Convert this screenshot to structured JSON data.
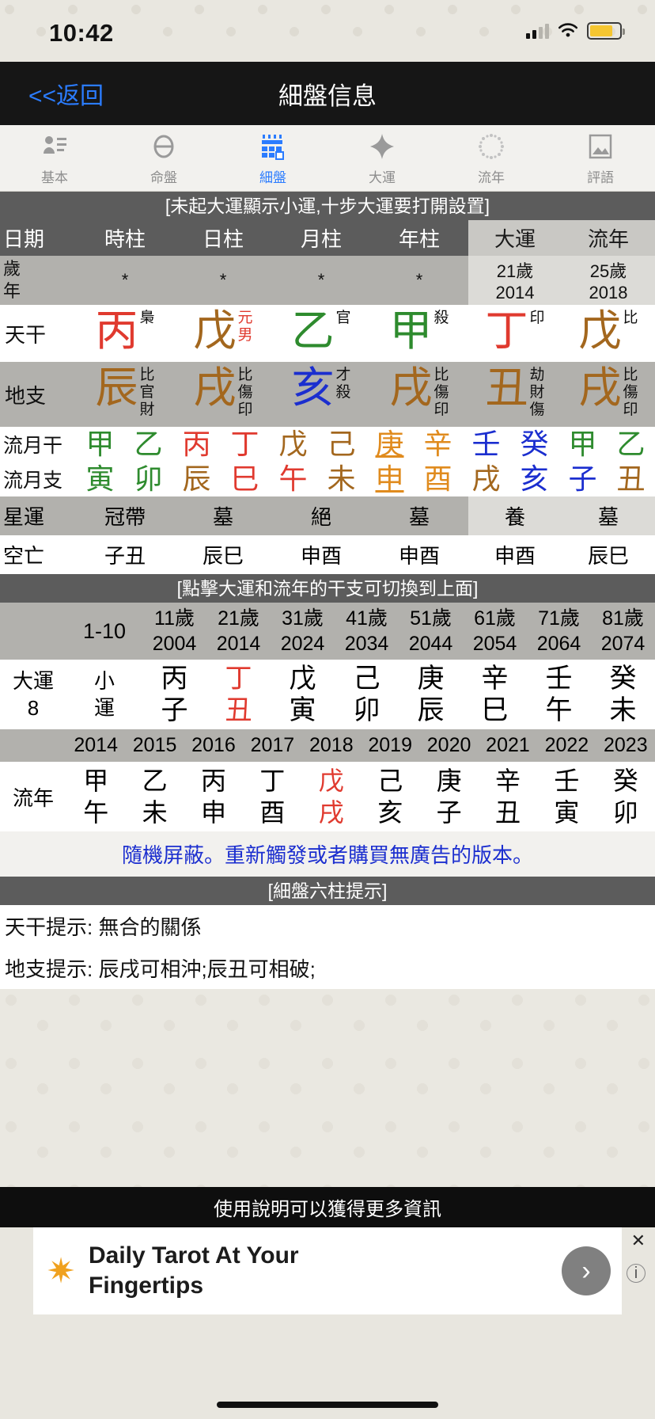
{
  "status": {
    "time": "10:42"
  },
  "nav": {
    "back": "<<返回",
    "title": "細盤信息"
  },
  "tabs": [
    {
      "label": "基本",
      "icon": "person-list-icon",
      "active": false
    },
    {
      "label": "命盤",
      "icon": "oval-divider-icon",
      "active": false
    },
    {
      "label": "細盤",
      "icon": "calendar-grid-icon",
      "active": true
    },
    {
      "label": "大運",
      "icon": "diamond-icon",
      "active": false
    },
    {
      "label": "流年",
      "icon": "dotted-circle-icon",
      "active": false
    },
    {
      "label": "評語",
      "icon": "picture-icon",
      "active": false
    }
  ],
  "notice_top": "[未起大運顯示小運,十步大運要打開設置]",
  "table": {
    "headers": [
      "日期",
      "時柱",
      "日柱",
      "月柱",
      "年柱",
      "大運",
      "流年"
    ],
    "age_label": "歲",
    "year_label": "年",
    "age_values": [
      "*",
      "*",
      "*",
      "*"
    ],
    "dayun": {
      "age": "21歲",
      "year": "2014"
    },
    "liunian": {
      "age": "25歲",
      "year": "2018"
    },
    "stems_label": "天干",
    "stems": [
      {
        "char": "丙",
        "color": "#e03a2f",
        "anns": [
          "梟"
        ],
        "ann_colors": [
          "#111111"
        ]
      },
      {
        "char": "戊",
        "color": "#a3671e",
        "anns": [
          "元",
          "男"
        ],
        "ann_colors": [
          "#e03a2f",
          "#e03a2f"
        ]
      },
      {
        "char": "乙",
        "color": "#2e8b2e",
        "anns": [
          "官"
        ],
        "ann_colors": [
          "#111111"
        ]
      },
      {
        "char": "甲",
        "color": "#2e8b2e",
        "anns": [
          "殺"
        ],
        "ann_colors": [
          "#111111"
        ]
      },
      {
        "char": "丁",
        "color": "#e03a2f",
        "anns": [
          "印"
        ],
        "ann_colors": [
          "#111111"
        ]
      },
      {
        "char": "戊",
        "color": "#a3671e",
        "anns": [
          "比"
        ],
        "ann_colors": [
          "#111111"
        ]
      }
    ],
    "branches_label": "地支",
    "branches": [
      {
        "char": "辰",
        "color": "#a3671e",
        "anns": [
          "比",
          "官",
          "財"
        ]
      },
      {
        "char": "戌",
        "color": "#a3671e",
        "anns": [
          "比",
          "傷",
          "印"
        ]
      },
      {
        "char": "亥",
        "color": "#1b2ecf",
        "anns": [
          "才",
          "殺"
        ]
      },
      {
        "char": "戌",
        "color": "#a3671e",
        "anns": [
          "比",
          "傷",
          "印"
        ]
      },
      {
        "char": "丑",
        "color": "#a3671e",
        "anns": [
          "劫",
          "財",
          "傷"
        ]
      },
      {
        "char": "戌",
        "color": "#a3671e",
        "anns": [
          "比",
          "傷",
          "印"
        ]
      }
    ],
    "month_stem_label": "流月干",
    "month_stems": [
      {
        "c": "甲",
        "color": "#2e8b2e",
        "hl": false
      },
      {
        "c": "乙",
        "color": "#2e8b2e",
        "hl": false
      },
      {
        "c": "丙",
        "color": "#e03a2f",
        "hl": false
      },
      {
        "c": "丁",
        "color": "#e03a2f",
        "hl": false
      },
      {
        "c": "戊",
        "color": "#a3671e",
        "hl": false
      },
      {
        "c": "己",
        "color": "#a3671e",
        "hl": false
      },
      {
        "c": "庚",
        "color": "#e08b1e",
        "hl": true
      },
      {
        "c": "辛",
        "color": "#e08b1e",
        "hl": false
      },
      {
        "c": "壬",
        "color": "#1b2ecf",
        "hl": false
      },
      {
        "c": "癸",
        "color": "#1b2ecf",
        "hl": false
      },
      {
        "c": "甲",
        "color": "#2e8b2e",
        "hl": false
      },
      {
        "c": "乙",
        "color": "#2e8b2e",
        "hl": false
      }
    ],
    "month_branch_label": "流月支",
    "month_branches": [
      {
        "c": "寅",
        "color": "#2e8b2e",
        "hl": false
      },
      {
        "c": "卯",
        "color": "#2e8b2e",
        "hl": false
      },
      {
        "c": "辰",
        "color": "#a3671e",
        "hl": false
      },
      {
        "c": "巳",
        "color": "#e03a2f",
        "hl": false
      },
      {
        "c": "午",
        "color": "#e03a2f",
        "hl": false
      },
      {
        "c": "未",
        "color": "#a3671e",
        "hl": false
      },
      {
        "c": "申",
        "color": "#e08b1e",
        "hl": true
      },
      {
        "c": "酉",
        "color": "#e08b1e",
        "hl": false
      },
      {
        "c": "戌",
        "color": "#a3671e",
        "hl": false
      },
      {
        "c": "亥",
        "color": "#1b2ecf",
        "hl": false
      },
      {
        "c": "子",
        "color": "#1b2ecf",
        "hl": false
      },
      {
        "c": "丑",
        "color": "#a3671e",
        "hl": false
      }
    ],
    "star_label": "星運",
    "star_values": [
      "冠帶",
      "墓",
      "絕",
      "墓",
      "養",
      "墓"
    ],
    "void_label": "空亡",
    "void_values": [
      "子丑",
      "辰巳",
      "申酉",
      "申酉",
      "申酉",
      "辰巳"
    ]
  },
  "notice_mid": "[點擊大運和流年的干支可切換到上面]",
  "luck": {
    "first_range": "1-10",
    "ages": [
      "11歲",
      "21歲",
      "31歲",
      "41歲",
      "51歲",
      "61歲",
      "71歲",
      "81歲"
    ],
    "years": [
      "2004",
      "2014",
      "2024",
      "2034",
      "2044",
      "2054",
      "2064",
      "2074"
    ],
    "row_label_1": "大運",
    "row_label_2": "8",
    "small_luck": [
      "小",
      "運"
    ],
    "stems": [
      "丙",
      "丁",
      "戊",
      "己",
      "庚",
      "辛",
      "壬",
      "癸"
    ],
    "branches": [
      "子",
      "丑",
      "寅",
      "卯",
      "辰",
      "巳",
      "午",
      "未"
    ],
    "highlight_index": 1,
    "highlight_color": "#e03a2f"
  },
  "year_flow": {
    "label": "流年",
    "years": [
      "2014",
      "2015",
      "2016",
      "2017",
      "2018",
      "2019",
      "2020",
      "2021",
      "2022",
      "2023"
    ],
    "stems": [
      "甲",
      "乙",
      "丙",
      "丁",
      "戊",
      "己",
      "庚",
      "辛",
      "壬",
      "癸"
    ],
    "branches": [
      "午",
      "未",
      "申",
      "酉",
      "戌",
      "亥",
      "子",
      "丑",
      "寅",
      "卯"
    ],
    "highlight_index": 4,
    "highlight_color": "#e03a2f"
  },
  "ad_message": "隨機屏蔽。重新觸發或者購買無廣告的版本。",
  "notice_hints": "[細盤六柱提示]",
  "hints": {
    "stem_hint": "天干提示: 無合的關係",
    "branch_hint": "地支提示: 辰戌可相沖;辰丑可相破;"
  },
  "ad": {
    "label": "使用說明可以獲得更多資訊",
    "title_line1": "Daily Tarot At Your",
    "title_line2": "Fingertips",
    "star_icon": "sun-burst-icon",
    "arrow_icon": "chevron-right-icon",
    "close_icon": "close-icon",
    "info_icon": "info-icon"
  }
}
